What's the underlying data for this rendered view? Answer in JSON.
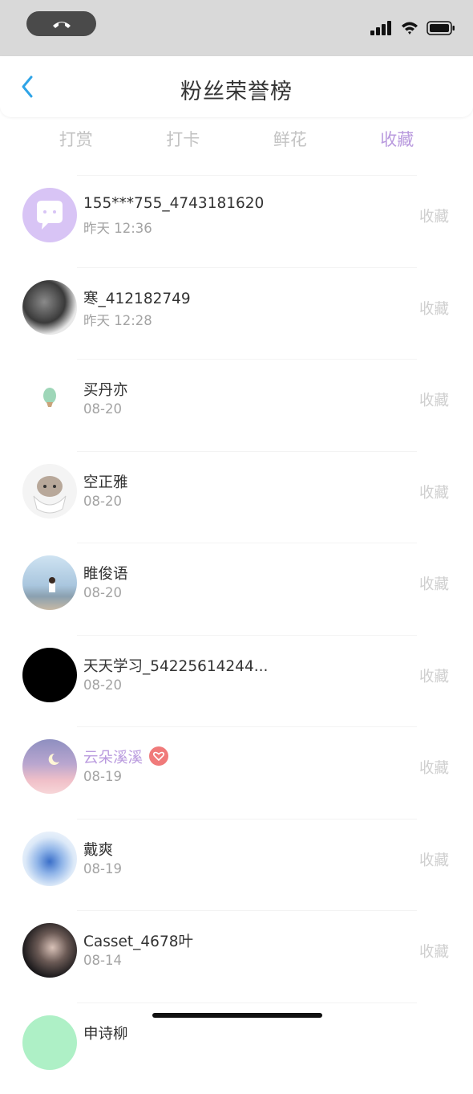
{
  "header": {
    "title": "粉丝荣誉榜"
  },
  "tabs": [
    {
      "label": "打赏"
    },
    {
      "label": "打卡"
    },
    {
      "label": "鲜花"
    },
    {
      "label": "收藏"
    }
  ],
  "active_tab_color": "#b99ade",
  "list": [
    {
      "name": "155***755_4743181620",
      "time": "昨天 12:36",
      "action": "收藏"
    },
    {
      "name": "寒_412182749",
      "time": "昨天 12:28",
      "action": "收藏"
    },
    {
      "name": "买丹亦",
      "time": "08-20",
      "action": "收藏"
    },
    {
      "name": "空正雅",
      "time": "08-20",
      "action": "收藏"
    },
    {
      "name": "睢俊语",
      "time": "08-20",
      "action": "收藏"
    },
    {
      "name": "天天学习_54225614244...",
      "time": "08-20",
      "action": "收藏"
    },
    {
      "name": "云朵溪溪",
      "time": "08-19",
      "action": "收藏"
    },
    {
      "name": "戴爽",
      "time": "08-19",
      "action": "收藏"
    },
    {
      "name": "Casset_4678叶",
      "time": "08-14",
      "action": "收藏"
    },
    {
      "name": "申诗柳",
      "time": "",
      "action": ""
    }
  ]
}
